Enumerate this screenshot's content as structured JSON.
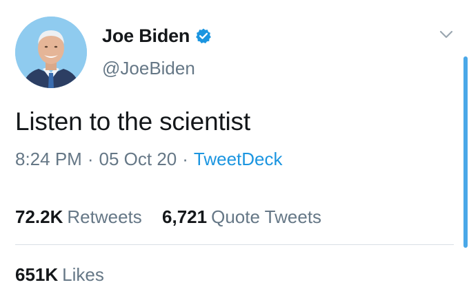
{
  "tweet": {
    "author": {
      "display_name": "Joe Biden",
      "handle": "@JoeBiden",
      "verified": true,
      "avatar_icon": "profile-photo"
    },
    "text": "Listen to the scientist",
    "meta": {
      "time": "8:24 PM",
      "separator": "·",
      "date": "05 Oct 20",
      "source": "TweetDeck"
    },
    "stats": {
      "retweets": {
        "value": "72.2K",
        "label": "Retweets"
      },
      "quote_tweets": {
        "value": "6,721",
        "label": "Quote Tweets"
      },
      "likes": {
        "value": "651K",
        "label": "Likes"
      }
    },
    "icons": {
      "verified": "verified-badge-icon",
      "menu": "chevron-down-icon"
    },
    "colors": {
      "accent": "#1b95e0",
      "secondary_text": "#657786",
      "primary_text": "#14171a",
      "divider": "#d9dfe4",
      "scroll_indicator": "#4aa8e8"
    }
  }
}
